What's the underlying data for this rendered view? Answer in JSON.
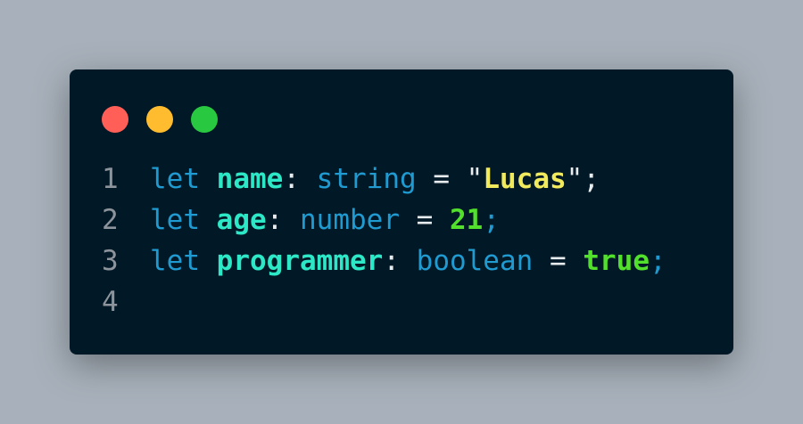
{
  "window": {
    "controls": [
      {
        "name": "close",
        "color": "#ff5f57"
      },
      {
        "name": "minimize",
        "color": "#febc2e"
      },
      {
        "name": "maximize",
        "color": "#28c840"
      }
    ],
    "background_color": "#011826"
  },
  "code": {
    "lines": [
      {
        "number": "1",
        "tokens": {
          "kw": "let",
          "sp1": " ",
          "id": "name",
          "colon": ":",
          "sp2": " ",
          "type": "string",
          "sp3": " ",
          "eq": "=",
          "sp4": " ",
          "quote_open": "\"",
          "value": "Lucas",
          "quote_close": "\"",
          "semi": ";"
        }
      },
      {
        "number": "2",
        "tokens": {
          "kw": "let",
          "sp1": " ",
          "id": "age",
          "colon": ":",
          "sp2": " ",
          "type": "number",
          "sp3": " ",
          "eq": "=",
          "sp4": " ",
          "value": "21",
          "semi": ";"
        }
      },
      {
        "number": "3",
        "tokens": {
          "kw": "let",
          "sp1": " ",
          "id": "programmer",
          "colon": ":",
          "sp2": " ",
          "type": "boolean",
          "sp3": " ",
          "eq": "=",
          "sp4": " ",
          "value": "true",
          "semi": ";"
        }
      },
      {
        "number": "4",
        "tokens": {}
      }
    ]
  }
}
